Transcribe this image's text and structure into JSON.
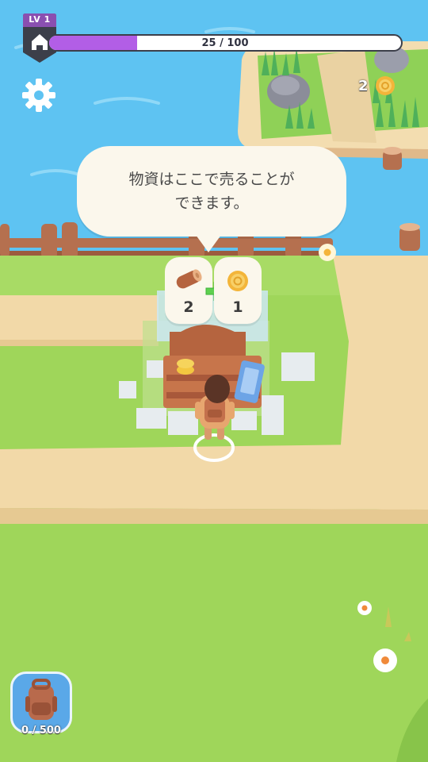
{
  "hud": {
    "level": "LV 1",
    "xp_text": "25 / 100",
    "xp_progress": 0.25,
    "coins": "2"
  },
  "tooltip": {
    "line1": "物資はここで売ることが",
    "line2": "できます。"
  },
  "trade": {
    "input_qty": "2",
    "input_item": "wood-log-icon",
    "output_qty": "1",
    "output_item": "coin-icon"
  },
  "backpack": {
    "capacity": "0 / 500"
  },
  "colors": {
    "water": "#5ec3f2",
    "grass": "#9fd65a",
    "path": "#f2d9a8",
    "xp_fill": "#b25ee6",
    "backpack_bg": "#5aa8e8"
  }
}
